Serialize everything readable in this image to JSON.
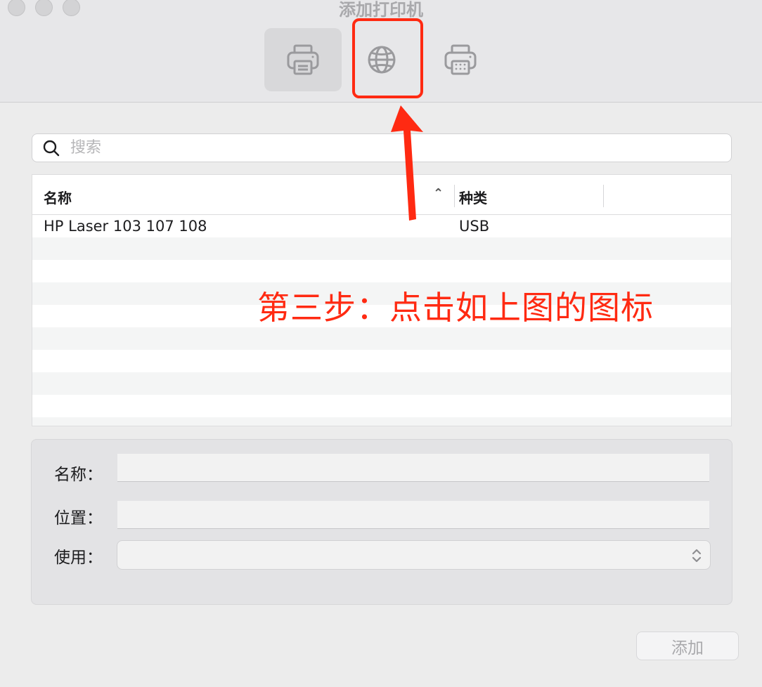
{
  "window": {
    "title": "添加打印机"
  },
  "toolbar": {
    "tools": [
      "default-printer",
      "ip-printer",
      "windows-printer"
    ],
    "selected": "default-printer",
    "icons": {
      "default": "printer-icon",
      "ip": "globe-icon",
      "windows": "fax-printer-icon"
    }
  },
  "search": {
    "placeholder": "搜索",
    "value": ""
  },
  "table": {
    "columns": {
      "name": "名称",
      "kind": "种类"
    },
    "rows": [
      {
        "name": "HP Laser 103 107 108",
        "kind": "USB"
      }
    ]
  },
  "details": {
    "name_label": "名称：",
    "location_label": "位置：",
    "use_label": "使用：",
    "name_value": "",
    "location_value": "",
    "use_value": ""
  },
  "actions": {
    "add_label": "添加"
  },
  "annotation": {
    "text": "第三步：点击如上图的图标",
    "color": "#ff2a12"
  }
}
